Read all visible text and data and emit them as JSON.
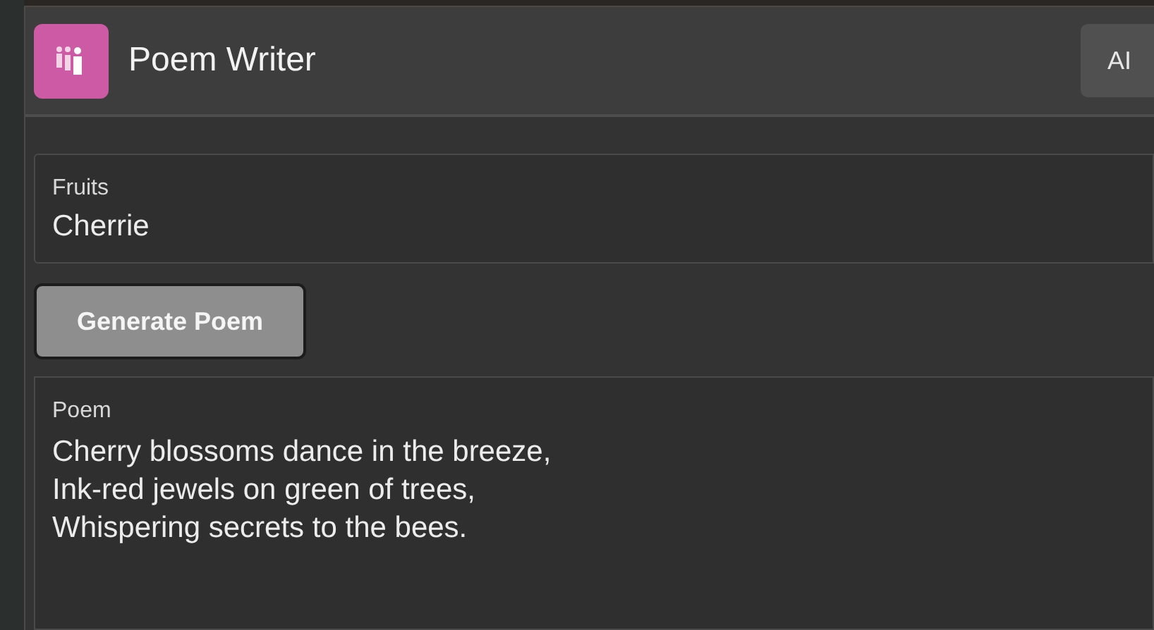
{
  "header": {
    "title": "Poem Writer",
    "badge": "AI"
  },
  "fruits_field": {
    "label": "Fruits",
    "value": "Cherrie"
  },
  "generate_button": {
    "label": "Generate Poem"
  },
  "poem_field": {
    "label": "Poem",
    "lines": [
      "Cherry blossoms dance in the breeze,",
      "Ink-red jewels on green of trees,",
      "Whispering secrets to the bees."
    ]
  }
}
